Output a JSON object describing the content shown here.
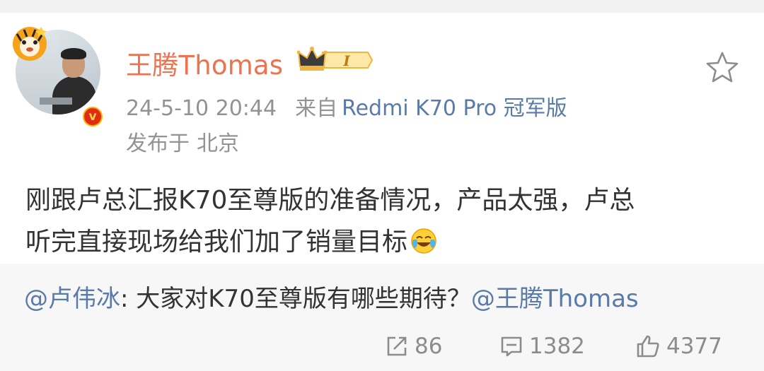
{
  "post": {
    "author": {
      "name": "王腾Thomas",
      "vip_level": "I"
    },
    "timestamp": "24-5-10 20:44",
    "from_label": "来自",
    "device": "Redmi K70 Pro 冠军版",
    "location_label": "发布于",
    "location": "北京",
    "text_line1": "刚跟卢总汇报K70至尊版的准备情况，产品太强，卢总",
    "text_line2": "听完直接现场给我们加了销量目标",
    "emoji": "laugh-cry-emoji"
  },
  "repost": {
    "author_mention": "@卢伟冰",
    "separator": ": ",
    "text": "大家对K70至尊版有哪些期待？",
    "mention": "@王腾Thomas"
  },
  "actions": {
    "share_count": "86",
    "comment_count": "1382",
    "like_count": "4377"
  },
  "colors": {
    "username": "#eb7350",
    "link": "#5a7aa8",
    "meta": "#939393",
    "repost_bg": "#f7f7f7"
  }
}
